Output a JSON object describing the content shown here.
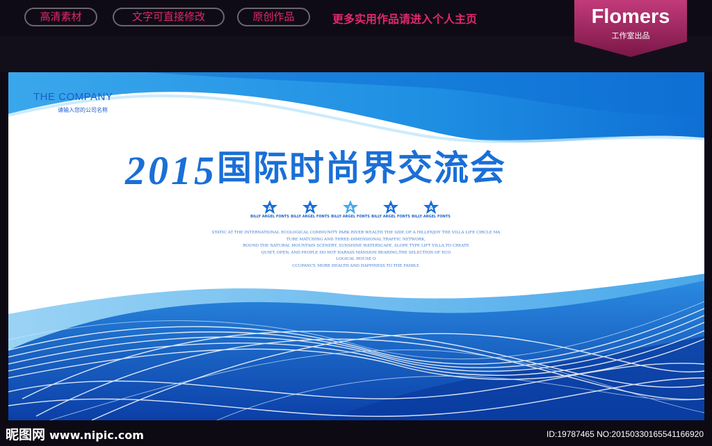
{
  "topbar": {
    "tags": [
      "高清素材",
      "文字可直接修改",
      "原创作品"
    ],
    "more_link": "更多实用作品请进入个人主页",
    "brand_name": "Flomers",
    "brand_sub": "工作室出品",
    "accent": "#e0286e"
  },
  "banner": {
    "company": "THE COMPANY",
    "company_sub": "请输入您的公司名称",
    "year": "2015",
    "event_title": "国际时尚界交流会",
    "star_letter": "A",
    "star_labels": [
      "BILLY ARGEL FONTS",
      "BILLY ARGEL FONTS",
      "BILLY ARGEL FONTS",
      "BILLY ARGEL FONTS",
      "BILLY ARGEL FONTS"
    ],
    "body_lines": [
      "STATIC AT THE INTERNATIONAL ECOLOGICAL COMMUNITY PARK RIVER WEALTH THE SIDE OF A HILLENJOY THE VILLA LIFE CIRCLE MA",
      "TURE MATCHING AND THREE-DIMENSIONAL TRAFFIC NETWORK,",
      "ROUND THE NATURAL MOUNTAIN SCENERY, SUNSHINE WATERSCAPE, SLOPE TYPE LIFT VILLA,TO CREATE",
      "QUIET, OPEN, AND PEOPLE DO NOT HARASS MANSION BEARING,THE SELECTION OF ECO",
      "LOGICAL HOUSE O",
      "CCUPANCY, MORE HEALTH AND HAPPINESS TO THE FAMILY."
    ],
    "primary_color": "#1a6fd6"
  },
  "watermark": {
    "logo": "昵图网",
    "url": "www.nipic.com",
    "id_text": "ID:19787465 NO:20150330165541166920"
  }
}
